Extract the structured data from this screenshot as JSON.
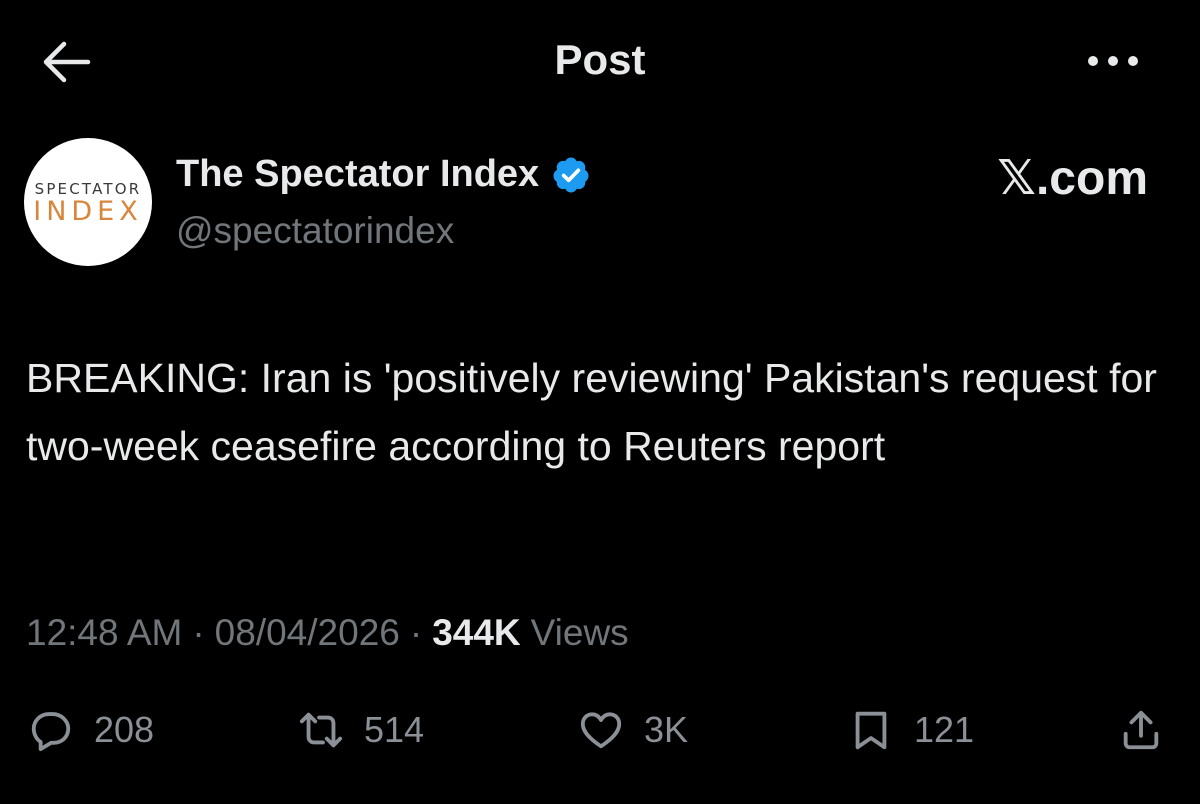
{
  "header": {
    "title": "Post"
  },
  "author": {
    "avatar_top": "SPECTATOR",
    "avatar_bottom": "INDEX",
    "name": "The Spectator Index",
    "handle": "@spectatorindex",
    "verified_color": "#1d9bf0"
  },
  "watermark": "𝕏.com",
  "post": {
    "text": "BREAKING: Iran is 'positively reviewing' Pakistan's request for two-week ceasefire according to Reuters report",
    "time": "12:48 AM",
    "separator": "·",
    "date": "08/04/2026",
    "views_count": "344K",
    "views_label": "Views"
  },
  "actions": {
    "replies": "208",
    "reposts": "514",
    "likes": "3K",
    "bookmarks": "121"
  },
  "icons": [
    "back-arrow-icon",
    "more-icon",
    "verified-badge-icon",
    "reply-icon",
    "repost-icon",
    "like-icon",
    "bookmark-icon",
    "share-icon"
  ],
  "colors": {
    "background": "#000000",
    "primary_text": "#e7e9ea",
    "secondary_text": "#71767b",
    "verified": "#1d9bf0",
    "avatar_accent": "#d9853b"
  }
}
